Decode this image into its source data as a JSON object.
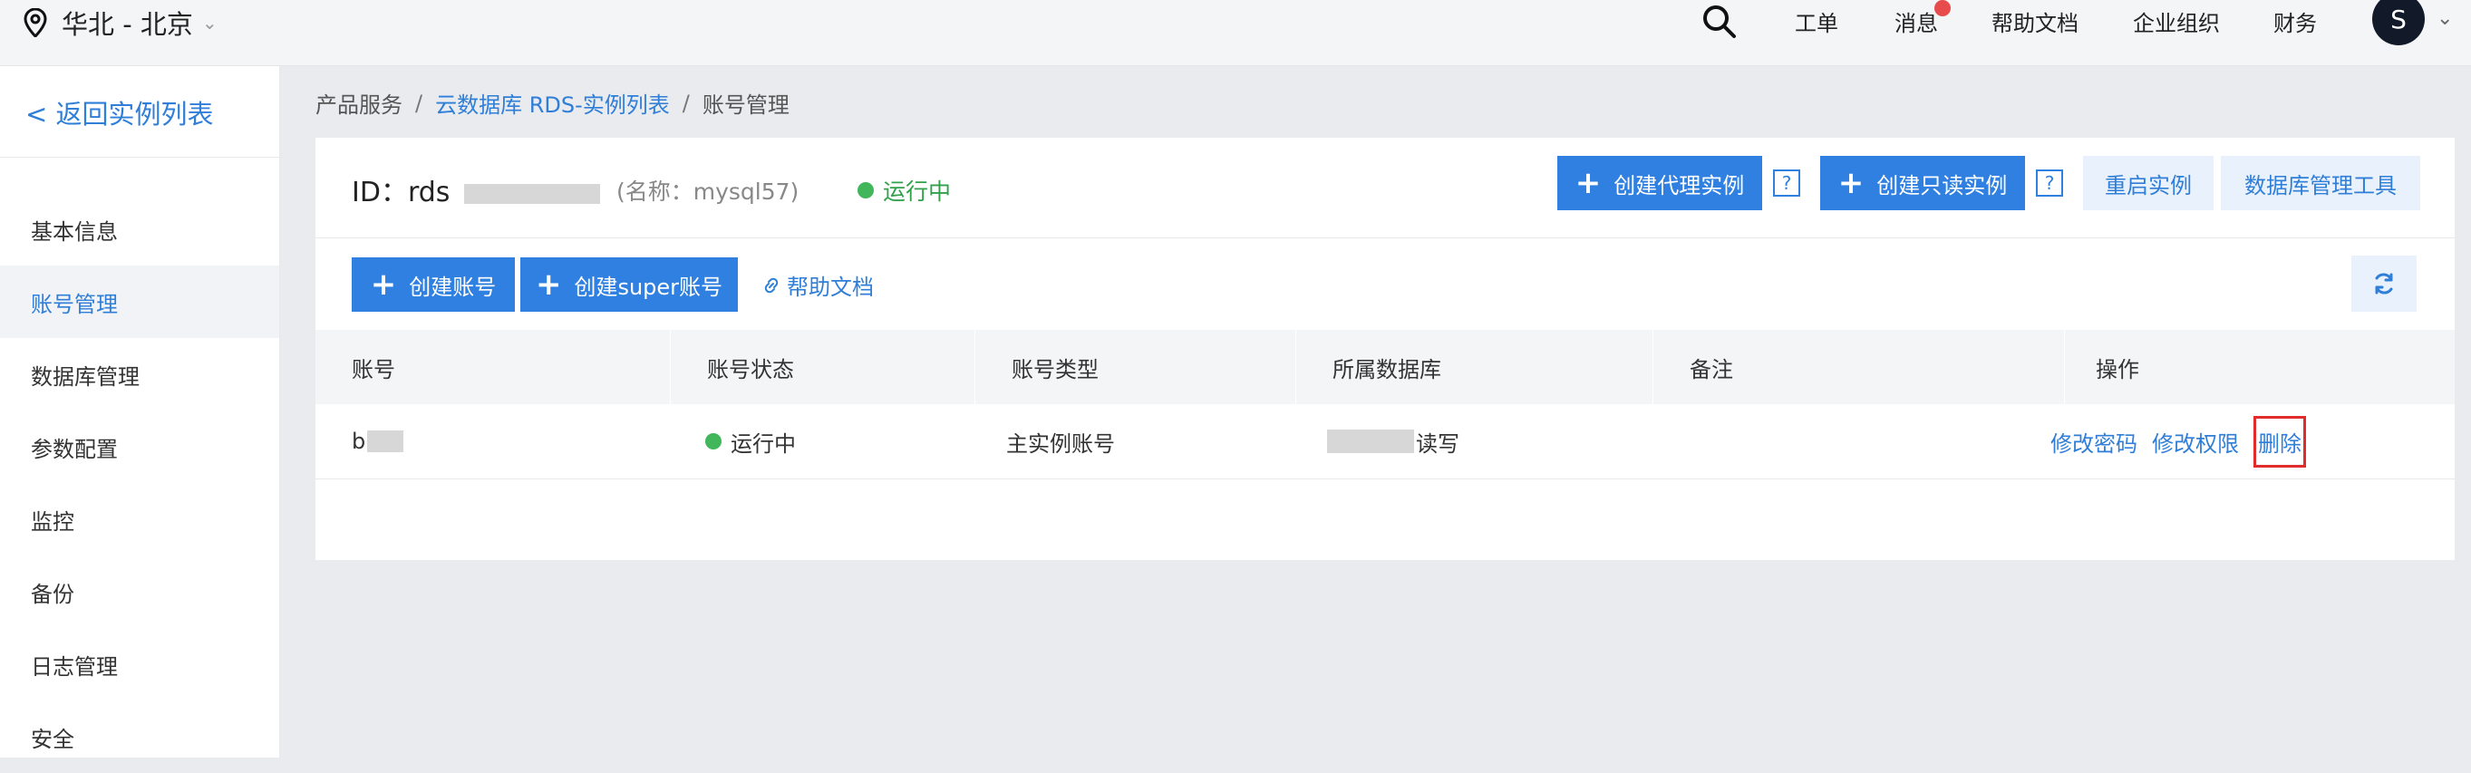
{
  "topbar": {
    "region": "华北 - 北京",
    "nav": [
      "工单",
      "消息",
      "帮助文档",
      "企业组织",
      "财务"
    ],
    "avatar": "S",
    "colors": {
      "notification_badge": "#e84b4b",
      "avatar_bg": "#121a2a"
    }
  },
  "sidebar": {
    "back": "< 返回实例列表",
    "items": [
      {
        "label": "基本信息"
      },
      {
        "label": "账号管理",
        "active": true
      },
      {
        "label": "数据库管理"
      },
      {
        "label": "参数配置"
      },
      {
        "label": "监控"
      },
      {
        "label": "备份"
      },
      {
        "label": "日志管理"
      },
      {
        "label": "安全"
      }
    ]
  },
  "breadcrumb": [
    "产品服务",
    "云数据库 RDS-实例列表",
    "账号管理"
  ],
  "instance": {
    "id_label": "ID：rds",
    "alias": "(名称：mysql57)",
    "status": "运行中"
  },
  "header_buttons": {
    "create_proxy": "创建代理实例",
    "create_readonly": "创建只读实例",
    "help_mark": "?",
    "restart": "重启实例",
    "db_tool": "数据库管理工具"
  },
  "toolbar": {
    "create_account": "创建账号",
    "create_super": "创建super账号",
    "help_doc": "帮助文档"
  },
  "table": {
    "columns": [
      "账号",
      "账号状态",
      "账号类型",
      "所属数据库",
      "备注",
      "操作"
    ],
    "rows": [
      {
        "account": "b",
        "status": "运行中",
        "type": "主实例账号",
        "database": "读写",
        "note": "",
        "actions": [
          "修改密码",
          "修改权限",
          "删除"
        ]
      }
    ]
  },
  "colors": {
    "primary": "#2f80e0",
    "link": "#2f7ed8",
    "status_green": "#41b65b",
    "highlight_red": "#e12c2c"
  }
}
